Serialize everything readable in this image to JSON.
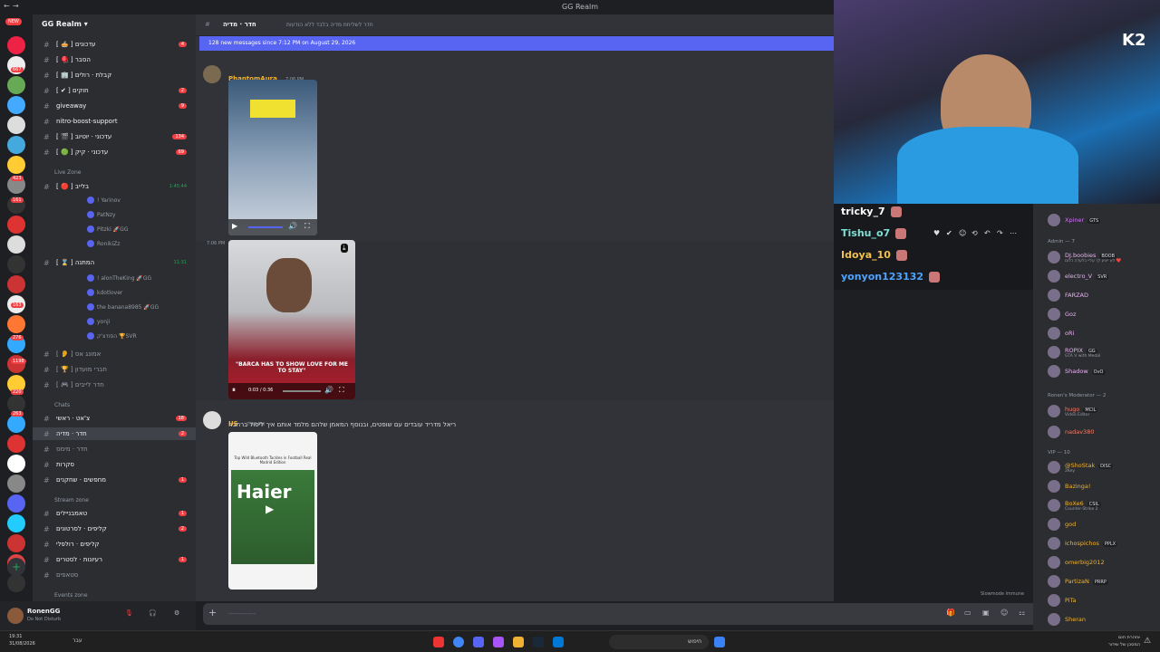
{
  "window": {
    "title": "GG Realm"
  },
  "server": {
    "name": "GG Realm"
  },
  "colors": {
    "accent": "#5865f2",
    "badge": "#f23f43",
    "online": "#23a55a",
    "author1": "#f0b232",
    "author2": "#f0b232"
  },
  "rail_badges": [
    "NEW",
    "667",
    "423",
    "161",
    "163",
    "276",
    "1198",
    "220",
    "263"
  ],
  "channels_top": [
    {
      "name": "[ 🥧 ] עדכונים",
      "badge": "4"
    },
    {
      "name": "[ 🪀 ] הסבר",
      "badge": ""
    },
    {
      "name": "[ 🏢 ] קבלת · רולים",
      "badge": ""
    },
    {
      "name": "[ ✔ ] חוקים",
      "badge": "2"
    },
    {
      "name": "giveaway",
      "badge": "9"
    },
    {
      "name": "nitro-boost-support",
      "badge": ""
    },
    {
      "name": "[ 🎬 ] עדכוני · יוטיוב",
      "badge": "134"
    },
    {
      "name": "[ 🟢 ] עדכוני · קיק",
      "badge": "69"
    }
  ],
  "categories": {
    "live": "Live Zone",
    "chats": "Chats",
    "stream": "Stream zone",
    "events": "Events zone"
  },
  "voice1": {
    "name": "[ 🔴 ] בלייב",
    "time": "1:45:44",
    "users": [
      "! Yarinov",
      "PatNzy",
      "Pitzki 🚀GG",
      "RonikiZz"
    ]
  },
  "voice2": {
    "name": "[ ⌛ ] המתנה",
    "time": "11:31",
    "users": [
      "! alonTheKing 🚀GG",
      "kdotlover",
      "the banana8985 🚀GG",
      "yonji",
      "הסודצ'ק 🏆SVR"
    ]
  },
  "voice_more": [
    "[ 👂 ] אמונג אס",
    "[ 🏆 ] חברי מועדון",
    "[ 🎮 ] חדר לייבים"
  ],
  "chats": [
    {
      "name": "צ'אט · ראשי",
      "badge": "18"
    },
    {
      "name": "חדר · מדיה",
      "badge": "2"
    },
    {
      "name": "חדר · מימס",
      "badge": ""
    },
    {
      "name": "סקרות",
      "badge": ""
    },
    {
      "name": "מחפשים · שחקנים",
      "badge": "1"
    }
  ],
  "stream_chans": [
    {
      "name": "טאמבניילים",
      "badge": "1"
    },
    {
      "name": "קליפים · לסרטונים",
      "badge": "2"
    },
    {
      "name": "קליפים · רולפלי",
      "badge": ""
    },
    {
      "name": "רעיונות · לסטרים",
      "badge": "1"
    },
    {
      "name": "סטאפים",
      "badge": ""
    }
  ],
  "user": {
    "name": "RonenGG",
    "status": "Do Not Disturb"
  },
  "chat": {
    "channel": "חדר · מדיה",
    "topic": "חדר לשליחת מדיה בלבד ללא הודעות",
    "new_banner": "128 new messages since 7:12 PM on August 29, 2026",
    "msg1": {
      "author": "PhantomAura",
      "time": "7:06 PM"
    },
    "msg2_time": "7:06 PM",
    "video2": {
      "caption": "\"BARCA HAS TO SHOW LOVE FOR ME TO STAY\"",
      "time": "0:03 / 0:36"
    },
    "msg3": {
      "author": "US",
      "time": "7:07 PM",
      "text": "ריאל מדריד עובדים עם שופטים, ובנוסף המאמן שלהם מלמד אותם איך ליפול ברחבה"
    },
    "video3": {
      "caption": "Top Wild Bluetooth Tackles in Football Real Madrid Edition",
      "brand": "Haier"
    },
    "slowmode": "Slowmode immune"
  },
  "stream_chat": [
    {
      "user": "tricky_7",
      "color": "#ffffff"
    },
    {
      "user": "Tishu_o7",
      "color": "#7ee0d6"
    },
    {
      "user": "Idoya_10",
      "color": "#f0c050"
    },
    {
      "user": "yonyon123132",
      "color": "#4fa3ff"
    }
  ],
  "cam_logo": "K2",
  "members": {
    "top": {
      "name": "Xpiner",
      "tag": "GTS",
      "color": "#d175f0"
    },
    "admin_header": "Admin — 7",
    "admins": [
      {
        "name": "DJ.boobies",
        "tag": "BOOB",
        "color": "#e9b2f0",
        "sub": "לא ייגיע לך עליי בלעדה כלום ❤️"
      },
      {
        "name": "electro_V",
        "tag": "SVR",
        "color": "#e9b2f0",
        "sub": ""
      },
      {
        "name": "FARZAD",
        "tag": "",
        "color": "#e9b2f0",
        "sub": ""
      },
      {
        "name": "Goz",
        "tag": "",
        "color": "#e9b2f0",
        "sub": ""
      },
      {
        "name": "oRi",
        "tag": "",
        "color": "#e9b2f0",
        "sub": ""
      },
      {
        "name": "ROPIX",
        "tag": "GG",
        "color": "#e9b2f0",
        "sub": "GTA V with Medal"
      },
      {
        "name": "Shadow",
        "tag": "OvO",
        "color": "#e9b2f0",
        "sub": ""
      }
    ],
    "mod_header": "Ronen's Moderator — 2",
    "mods": [
      {
        "name": "hugo",
        "tag": "MCIL",
        "color": "#f47b67",
        "sub": "Video Editor"
      },
      {
        "name": "nadav380",
        "tag": "",
        "color": "#f47b67",
        "sub": ""
      }
    ],
    "vip_header": "VIP — 10",
    "vips": [
      {
        "name": "@ShoStak",
        "tag": "DISC",
        "color": "#f0b232",
        "sub": "2Key"
      },
      {
        "name": "Bazinga!",
        "tag": "",
        "color": "#f0b232",
        "sub": ""
      },
      {
        "name": "BoXe6",
        "tag": "CSIL",
        "color": "#f0b232",
        "sub": "Counter-Strike 2"
      },
      {
        "name": "god",
        "tag": "",
        "color": "#f0b232",
        "sub": ""
      },
      {
        "name": "ichospichos",
        "tag": "PPLX",
        "color": "#f0b232",
        "sub": ""
      },
      {
        "name": "omerbig2012",
        "tag": "",
        "color": "#f0b232",
        "sub": ""
      },
      {
        "name": "PartizaN",
        "tag": "PRRP",
        "color": "#f0b232",
        "sub": ""
      },
      {
        "name": "PiTa",
        "tag": "",
        "color": "#f0b232",
        "sub": ""
      },
      {
        "name": "Sheran",
        "tag": "",
        "color": "#f0b232",
        "sub": ""
      }
    ]
  },
  "taskbar": {
    "time": "19:31",
    "date": "31/08/2026",
    "search": "חיפוש",
    "lang": "עבר",
    "tray_text": "אזהרת חום",
    "tray_sub": "המסכן של שידור"
  }
}
